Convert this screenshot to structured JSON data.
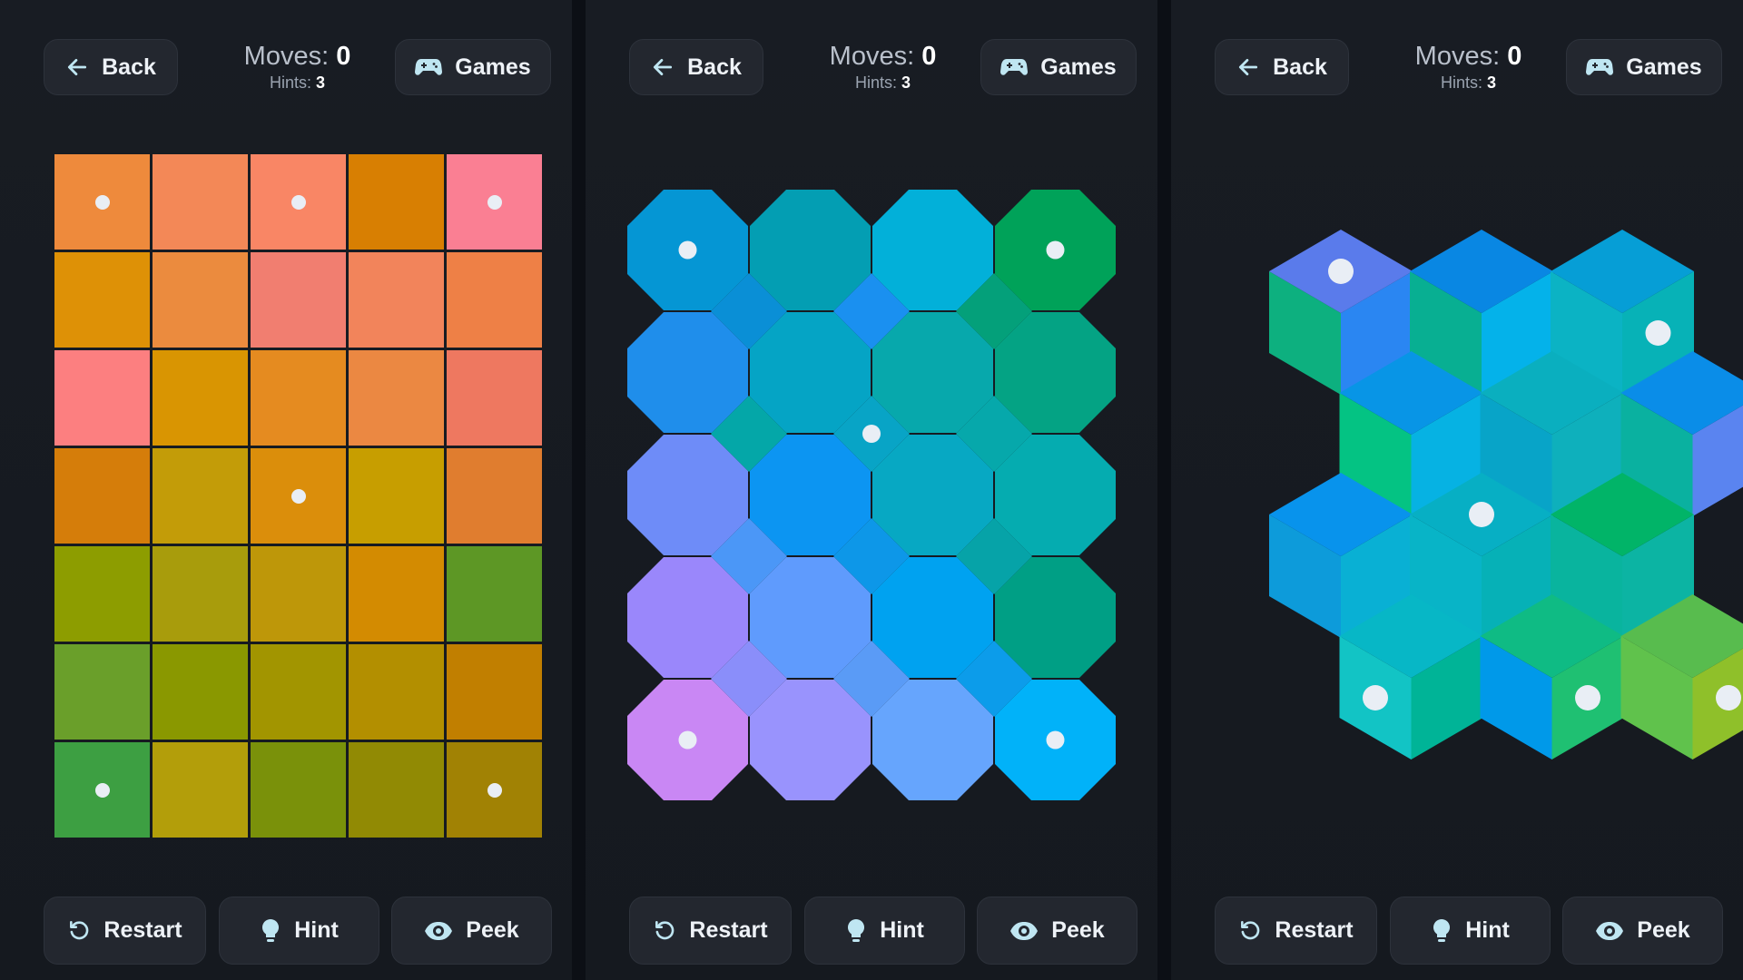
{
  "buttons": {
    "back": "Back",
    "games": "Games",
    "restart": "Restart",
    "hint": "Hint",
    "peek": "Peek"
  },
  "stats": {
    "moves_label": "Moves:",
    "moves_value": "0",
    "hints_label": "Hints:",
    "hints_value": "3"
  },
  "icons": {
    "back": "arrow-left-icon",
    "games": "gamepad-icon",
    "restart": "restart-icon",
    "hint": "lightbulb-icon",
    "peek": "eye-icon"
  },
  "puzzles": [
    {
      "shape": "square",
      "rows": 7,
      "cols": 5,
      "colors": [
        [
          "#EE8A3C",
          "#F38857",
          "#F98665",
          "#D87F02",
          "#FA7F93"
        ],
        [
          "#DE9106",
          "#EB8B3E",
          "#F17E70",
          "#F2845B",
          "#EE8046"
        ],
        [
          "#FC7F80",
          "#D99502",
          "#E58B20",
          "#EB8842",
          "#EE7860"
        ],
        [
          "#D57D0A",
          "#C39C08",
          "#DB8E0B",
          "#C79E00",
          "#E07D2F"
        ],
        [
          "#8D9D00",
          "#A89C0C",
          "#BE9709",
          "#D38B01",
          "#5D9725"
        ],
        [
          "#6A9F2A",
          "#8A9800",
          "#A29500",
          "#B38F00",
          "#C17F00"
        ],
        [
          "#3D9F42",
          "#B39E0A",
          "#7A910A",
          "#918A04",
          "#A18204"
        ]
      ],
      "anchors": [
        [
          0,
          0
        ],
        [
          0,
          2
        ],
        [
          0,
          4
        ],
        [
          3,
          2
        ],
        [
          6,
          0
        ],
        [
          6,
          4
        ]
      ]
    },
    {
      "shape": "octagon",
      "rows": 5,
      "cols": 4,
      "colors": [
        [
          "#0596D4",
          "#039EB3",
          "#02B0D9",
          "#00A259"
        ],
        [
          "#1F8EEB",
          "#05A4C5",
          "#07A8AC",
          "#04A384"
        ],
        [
          "#6E8CF8",
          "#0C95F2",
          "#07A8C3",
          "#05ACB0"
        ],
        [
          "#9A87FB",
          "#5F9BFD",
          "#00A2F0",
          "#009F85"
        ],
        [
          "#C987F4",
          "#9993FD",
          "#66A5FD",
          "#01B2F9"
        ]
      ],
      "diamond_colors": [
        [
          "#0A8FD6",
          "#1A90F0",
          "#04A07A"
        ],
        [
          "#04A7A8",
          "#08A4C6",
          "#06A8AB"
        ],
        [
          "#4B97F7",
          "#0D97E8",
          "#06A3A8"
        ],
        [
          "#8A8EFA",
          "#5A9BF6",
          "#0C9CEA"
        ]
      ],
      "anchors": [
        [
          0,
          0
        ],
        [
          0,
          3
        ],
        [
          4,
          0
        ],
        [
          4,
          3
        ]
      ],
      "diamond_anchors": [
        [
          1,
          1
        ]
      ]
    },
    {
      "shape": "cube",
      "cubes": [
        {
          "col": 0,
          "row": 0,
          "top": "#5A7BEB",
          "left": "#0DB07F",
          "right": "#2A86F2",
          "dot": "top"
        },
        {
          "col": 1,
          "row": 0,
          "top": "#0987E3",
          "left": "#08AF92",
          "right": "#04B2EA",
          "dot": null
        },
        {
          "col": 2,
          "row": 0,
          "top": "#069ED6",
          "left": "#0BB3C4",
          "right": "#07B2B7",
          "dot": "right"
        },
        {
          "col": 0.5,
          "row": 1,
          "top": "#0895E6",
          "left": "#04C383",
          "right": "#06B2E3",
          "dot": null
        },
        {
          "col": 1.5,
          "row": 1,
          "top": "#0AAFBF",
          "left": "#08A4C8",
          "right": "#0EB0BC",
          "dot": null
        },
        {
          "col": 2.5,
          "row": 1,
          "top": "#0A8DE8",
          "left": "#0AB1A0",
          "right": "#5A84F0",
          "dot": null
        },
        {
          "col": 0,
          "row": 2,
          "top": "#0893EC",
          "left": "#0D9BDA",
          "right": "#09B0D4",
          "dot": null
        },
        {
          "col": 1,
          "row": 2,
          "top": "#07AFC4",
          "left": "#08B4C7",
          "right": "#06B1B7",
          "dot": "top"
        },
        {
          "col": 2,
          "row": 2,
          "top": "#01B468",
          "left": "#09B49E",
          "right": "#0CB4A3",
          "dot": null
        },
        {
          "col": 0.5,
          "row": 3,
          "top": "#07B7C6",
          "left": "#12C4C5",
          "right": "#00B497",
          "dot": "left"
        },
        {
          "col": 1.5,
          "row": 3,
          "top": "#0FBB84",
          "left": "#0099E9",
          "right": "#1FC072",
          "dot": "right"
        },
        {
          "col": 2.5,
          "row": 3,
          "top": "#58BC4E",
          "left": "#60C24C",
          "right": "#8FC02A",
          "dot": "right"
        }
      ]
    }
  ]
}
